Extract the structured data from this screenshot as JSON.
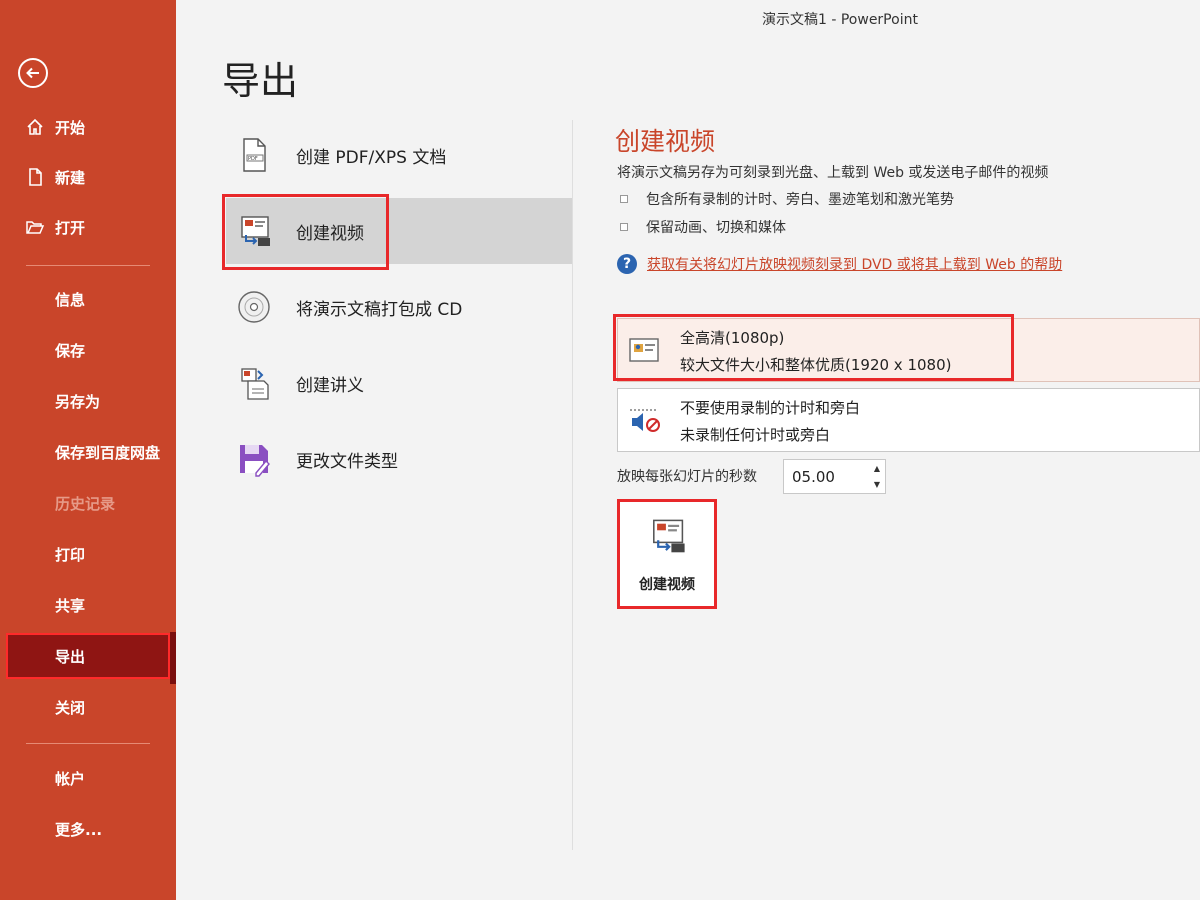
{
  "window": {
    "title": "演示文稿1 - PowerPoint"
  },
  "sidebar": {
    "back_icon": "back-arrow-icon",
    "items": [
      {
        "label": "开始",
        "icon": "home-icon"
      },
      {
        "label": "新建",
        "icon": "new-document-icon"
      },
      {
        "label": "打开",
        "icon": "open-folder-icon"
      },
      {
        "label": "信息"
      },
      {
        "label": "保存"
      },
      {
        "label": "另存为"
      },
      {
        "label": "保存到百度网盘"
      },
      {
        "label": "历史记录",
        "disabled": true
      },
      {
        "label": "打印"
      },
      {
        "label": "共享"
      },
      {
        "label": "导出",
        "active": true
      },
      {
        "label": "关闭"
      },
      {
        "label": "帐户"
      },
      {
        "label": "更多..."
      }
    ],
    "colors": {
      "background": "#c9452a",
      "active": "#8f1513"
    }
  },
  "page": {
    "title": "导出"
  },
  "export_options": [
    {
      "label": "创建 PDF/XPS 文档",
      "icon": "pdf-document-icon"
    },
    {
      "label": "创建视频",
      "icon": "create-video-icon",
      "selected": true
    },
    {
      "label": "将演示文稿打包成 CD",
      "icon": "cd-disc-icon"
    },
    {
      "label": "创建讲义",
      "icon": "handout-icon"
    },
    {
      "label": "更改文件类型",
      "icon": "save-file-type-icon"
    }
  ],
  "panel": {
    "title": "创建视频",
    "description": "将演示文稿另存为可刻录到光盘、上载到 Web 或发送电子邮件的视频",
    "bullets": [
      "包含所有录制的计时、旁白、墨迹笔划和激光笔势",
      "保留动画、切换和媒体"
    ],
    "help_link": "获取有关将幻灯片放映视频刻录到 DVD 或将其上载到 Web 的帮助",
    "quality": {
      "title": "全高清(1080p)",
      "subtitle": "较大文件大小和整体优质(1920 x 1080)"
    },
    "narration": {
      "title": "不要使用录制的计时和旁白",
      "subtitle": "未录制任何计时或旁白"
    },
    "seconds_label": "放映每张幻灯片的秒数",
    "seconds_value": "05.00",
    "create_button": "创建视频"
  },
  "colors": {
    "accent": "#c9452a",
    "highlight_outline": "#e8282a"
  }
}
